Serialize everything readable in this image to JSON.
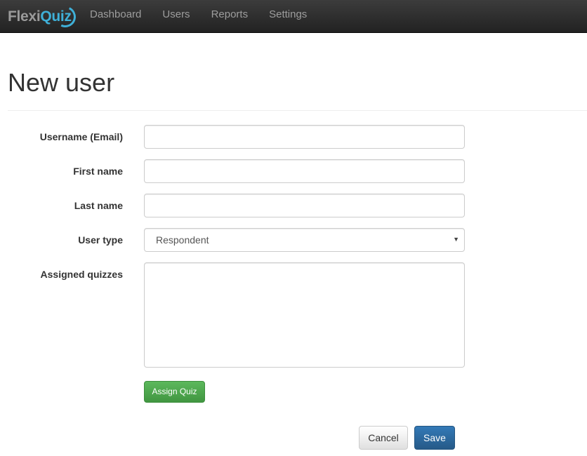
{
  "navbar": {
    "brand": {
      "part1": "Flexi",
      "part2": "Quiz"
    },
    "links": [
      {
        "label": "Dashboard"
      },
      {
        "label": "Users"
      },
      {
        "label": "Reports"
      },
      {
        "label": "Settings"
      }
    ]
  },
  "page": {
    "title": "New user"
  },
  "form": {
    "username": {
      "label": "Username (Email)",
      "value": "",
      "placeholder": ""
    },
    "first_name": {
      "label": "First name",
      "value": "",
      "placeholder": ""
    },
    "last_name": {
      "label": "Last name",
      "value": "",
      "placeholder": ""
    },
    "user_type": {
      "label": "User type",
      "selected": "Respondent",
      "caret": "▼"
    },
    "assigned_quizzes": {
      "label": "Assigned quizzes",
      "value": ""
    },
    "assign_quiz_button": "Assign Quiz",
    "cancel_button": "Cancel",
    "save_button": "Save"
  },
  "colors": {
    "brand_accent": "#3fb0d8",
    "success": "#5cb85c",
    "primary": "#337ab7",
    "navbar_bg": "#222222"
  }
}
